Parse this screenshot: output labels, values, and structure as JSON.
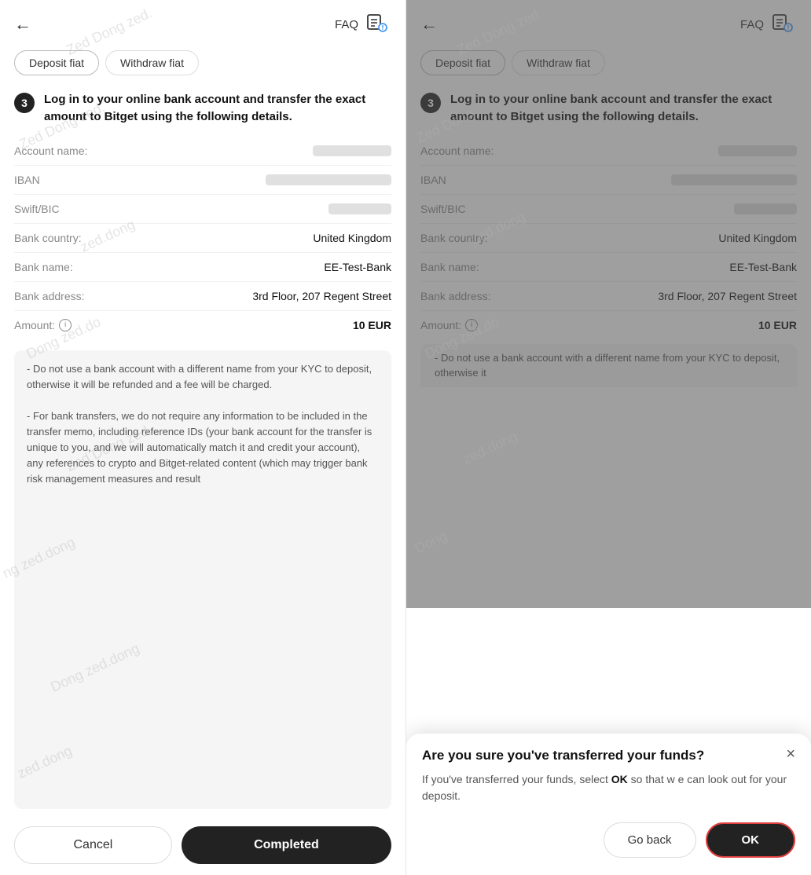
{
  "left": {
    "back_icon": "←",
    "faq_label": "FAQ",
    "tabs": [
      {
        "label": "Deposit fiat",
        "active": true
      },
      {
        "label": "Withdraw fiat",
        "active": false
      }
    ],
    "step": {
      "number": "3",
      "text": "Log in to your online bank account and transfer the exact amount to Bitget using the following details."
    },
    "details": [
      {
        "label": "Account name:",
        "value": "blurred",
        "type": "blurred-short"
      },
      {
        "label": "IBAN",
        "value": "blurred",
        "type": "blurred-long"
      },
      {
        "label": "Swift/BIC",
        "value": "blurred",
        "type": "blurred-med"
      },
      {
        "label": "Bank country:",
        "value": "United Kingdom",
        "type": "text"
      },
      {
        "label": "Bank name:",
        "value": "EE-Test-Bank",
        "type": "text"
      },
      {
        "label": "Bank address:",
        "value": "3rd Floor, 207 Regent Street",
        "type": "text"
      },
      {
        "label": "Amount:",
        "value": "10 EUR",
        "type": "bold"
      }
    ],
    "notice": "- Do not use a bank account with a different name from your KYC to deposit, otherwise it will be refunded and a fee will be charged.\n\n- For bank transfers, we do not require any information to be included in the transfer memo, including reference IDs (your bank account for the transfer is unique to you, and we will automatically match it and credit your account), any references to crypto and Bitget-related content (which may trigger bank risk management measures and result",
    "cancel_label": "Cancel",
    "completed_label": "Completed"
  },
  "right": {
    "back_icon": "←",
    "faq_label": "FAQ",
    "tabs": [
      {
        "label": "Deposit fiat",
        "active": true
      },
      {
        "label": "Withdraw fiat",
        "active": false
      }
    ],
    "step": {
      "number": "3",
      "text": "Log in to your online bank account and transfer the exact amount to Bitget using the following details."
    },
    "details": [
      {
        "label": "Account name:",
        "value": "blurred",
        "type": "blurred-short"
      },
      {
        "label": "IBAN",
        "value": "blurred",
        "type": "blurred-long"
      },
      {
        "label": "Swift/BIC",
        "value": "blurred",
        "type": "blurred-med"
      },
      {
        "label": "Bank country:",
        "value": "United Kingdom",
        "type": "text"
      },
      {
        "label": "Bank name:",
        "value": "EE-Test-Bank",
        "type": "text"
      },
      {
        "label": "Bank address:",
        "value": "3rd Floor, 207 Regent Street",
        "type": "text"
      },
      {
        "label": "Amount:",
        "value": "10 EUR",
        "type": "bold"
      }
    ],
    "notice_partial": "- Do not use a bank account with a different name from your KYC to deposit, otherwise it",
    "modal": {
      "title": "Are you sure you've transferred your funds?",
      "body_prefix": "If you've transferred your funds, select ",
      "body_bold": "OK",
      "body_suffix": " so that w e can look out for your deposit.",
      "close_icon": "×",
      "go_back_label": "Go back",
      "ok_label": "OK"
    }
  },
  "watermark": "Zed Dong zed."
}
